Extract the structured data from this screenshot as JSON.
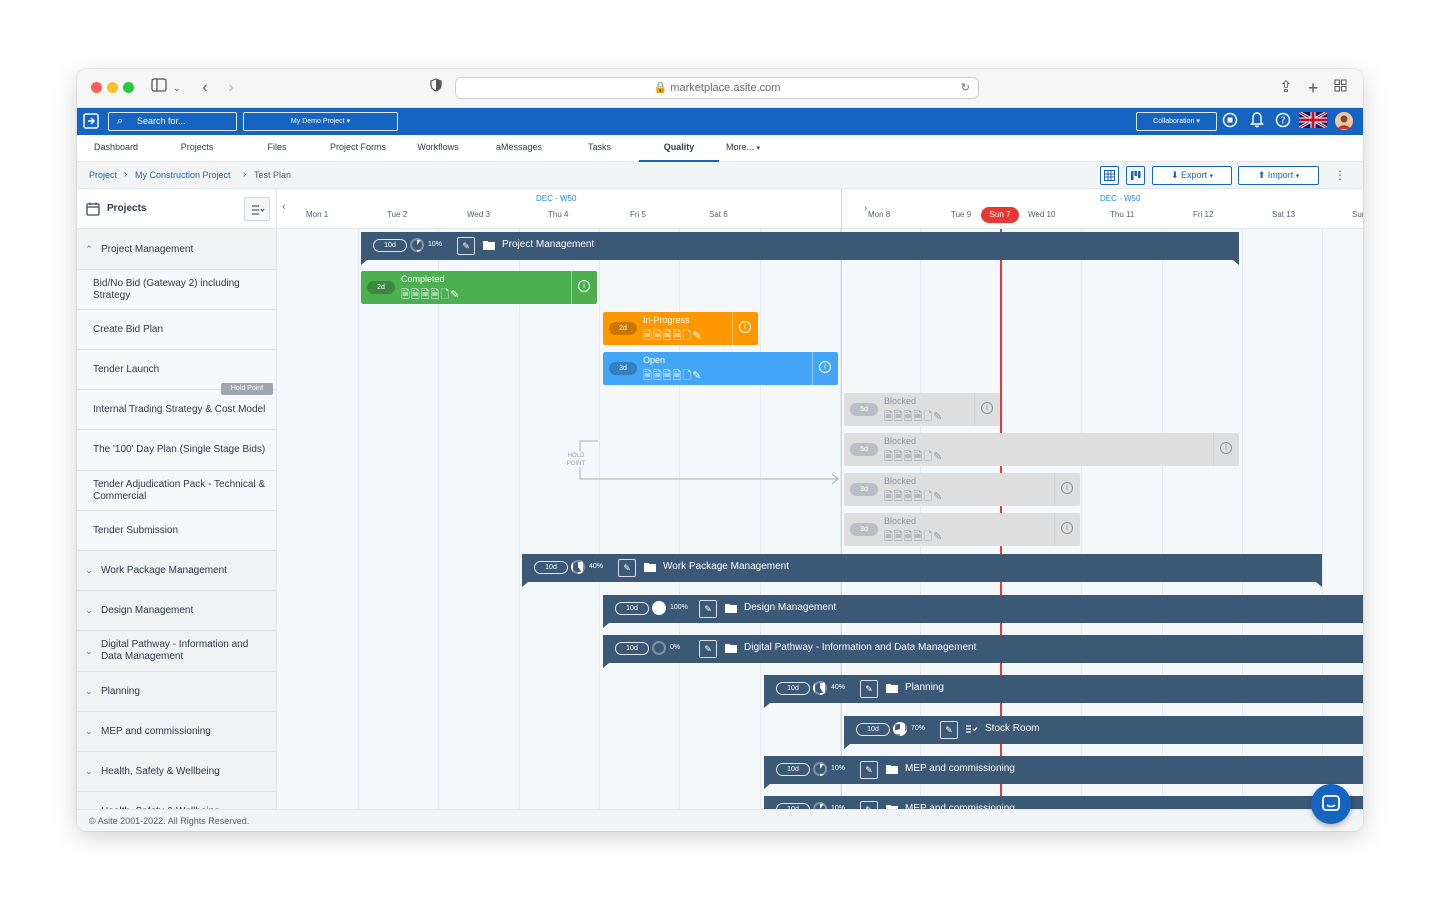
{
  "browser": {
    "url": "marketplace.asite.com"
  },
  "header": {
    "search_placeholder": "Search for...",
    "project_selector": "My Demo Project",
    "workspace_selector": "Collaboration"
  },
  "nav": {
    "tabs": [
      {
        "label": "Dashboard"
      },
      {
        "label": "Projects"
      },
      {
        "label": "Project Forms"
      },
      {
        "label": "Files"
      },
      {
        "label": "Workflows"
      },
      {
        "label": "aMessages"
      },
      {
        "label": "Tasks"
      },
      {
        "label": "Quality"
      },
      {
        "label": "More..."
      }
    ]
  },
  "breadcrumb": {
    "level1": "Project",
    "level2": "My Construction Project",
    "level3": "Test Plan"
  },
  "toolbar": {
    "export_label": "Export",
    "import_label": "Import"
  },
  "left_panel": {
    "title": "Projects",
    "hold_point_badge": "Hold Point",
    "rows": [
      {
        "label": "Project Management"
      },
      {
        "label": "Bid/No Bid (Gateway 2) including Strategy"
      },
      {
        "label": "Create Bid Plan"
      },
      {
        "label": "Tender Launch"
      },
      {
        "label": "Internal Trading Strategy & Cost Model"
      },
      {
        "label": "The '100' Day Plan (Single Stage Bids)"
      },
      {
        "label": "Tender Adjudication Pack - Technical & Commercial"
      },
      {
        "label": "Tender Submission"
      },
      {
        "label": "Work Package Management"
      },
      {
        "label": "Design Management"
      },
      {
        "label": "Digital Pathway - Information and Data Management"
      },
      {
        "label": "Planning"
      },
      {
        "label": "MEP and commissioning"
      },
      {
        "label": "Health, Safety & Wellbeing"
      },
      {
        "label": "Health, Safety & Wellbeing"
      }
    ]
  },
  "timeline": {
    "weeks": [
      "DEC - W50",
      "DEC - W50"
    ],
    "days": [
      "Mon 1",
      "Tue 2",
      "Wed 3",
      "Thu 4",
      "Fri 5",
      "Sat 6",
      "Sun 7",
      "Mon 8",
      "Tue 9",
      "Wed 10",
      "Thu 11",
      "Fri 12",
      "Sat 13",
      "Sun"
    ],
    "today": "Sun 7",
    "hold_point_label": "HOLD POINT",
    "summary_bars": [
      {
        "name": "Project Management",
        "duration": "10d",
        "percent": "10%",
        "progress": 0.1
      },
      {
        "name": "Work Package Management",
        "duration": "10d",
        "percent": "40%",
        "progress": 0.4
      },
      {
        "name": "Design Management",
        "duration": "10d",
        "percent": "100%",
        "progress": 1.0
      },
      {
        "name": "Digital Pathway - Information and Data Management",
        "duration": "10d",
        "percent": "0%",
        "progress": 0.0
      },
      {
        "name": "Planning",
        "duration": "10d",
        "percent": "40%",
        "progress": 0.4
      },
      {
        "name": "Stock Room",
        "duration": "10d",
        "percent": "70%",
        "progress": 0.7
      },
      {
        "name": "MEP and commissioning",
        "duration": "10d",
        "percent": "10%",
        "progress": 0.1
      },
      {
        "name": "MEP and commissioning",
        "duration": "10d",
        "percent": "10%",
        "progress": 0.1
      }
    ],
    "task_bars": [
      {
        "status": "Completed",
        "duration": "2d",
        "color": "#4caf50"
      },
      {
        "status": "In-Progress",
        "duration": "2d",
        "color": "#ff9800"
      },
      {
        "status": "Open",
        "duration": "3d",
        "color": "#42a5f5"
      },
      {
        "status": "Blocked",
        "duration": "5d",
        "color": "#dedede"
      },
      {
        "status": "Blocked",
        "duration": "5d",
        "color": "#dedede"
      },
      {
        "status": "Blocked",
        "duration": "3d",
        "color": "#dedede"
      },
      {
        "status": "Blocked",
        "duration": "3d",
        "color": "#dedede"
      }
    ]
  },
  "footer": {
    "copyright": "© Asite 2001-2022. All Rights Reserved."
  },
  "colors": {
    "brand": "#1565c0",
    "summary_bar": "#3b5876",
    "today": "#e53935"
  }
}
